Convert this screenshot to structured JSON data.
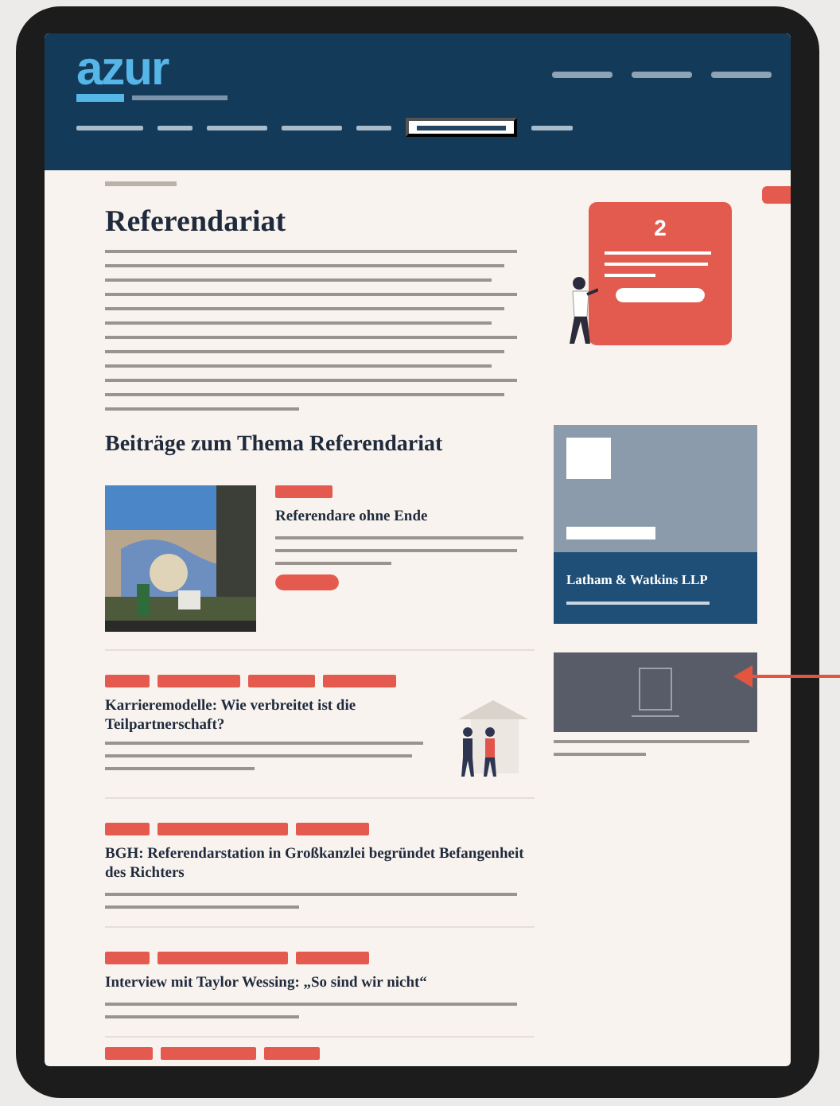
{
  "header": {
    "logo": "azur"
  },
  "page": {
    "title": "Referendariat",
    "section_title": "Beiträge zum Thema Referendariat"
  },
  "promo": {
    "count": "2"
  },
  "sponsor": {
    "name": "Latham & Watkins LLP"
  },
  "articles": [
    {
      "kind": "featured",
      "title": "Referendare ohne Ende"
    },
    {
      "kind": "illustrated",
      "title": "Karrieremodelle: Wie verbreitet ist die Teilpartnerschaft?"
    },
    {
      "kind": "plain",
      "title": "BGH: Referendarstation in Großkanzlei begründet Befangenheit des Richters"
    },
    {
      "kind": "plain",
      "title": "Interview mit Taylor Wessing: „So sind wir nicht“"
    }
  ]
}
